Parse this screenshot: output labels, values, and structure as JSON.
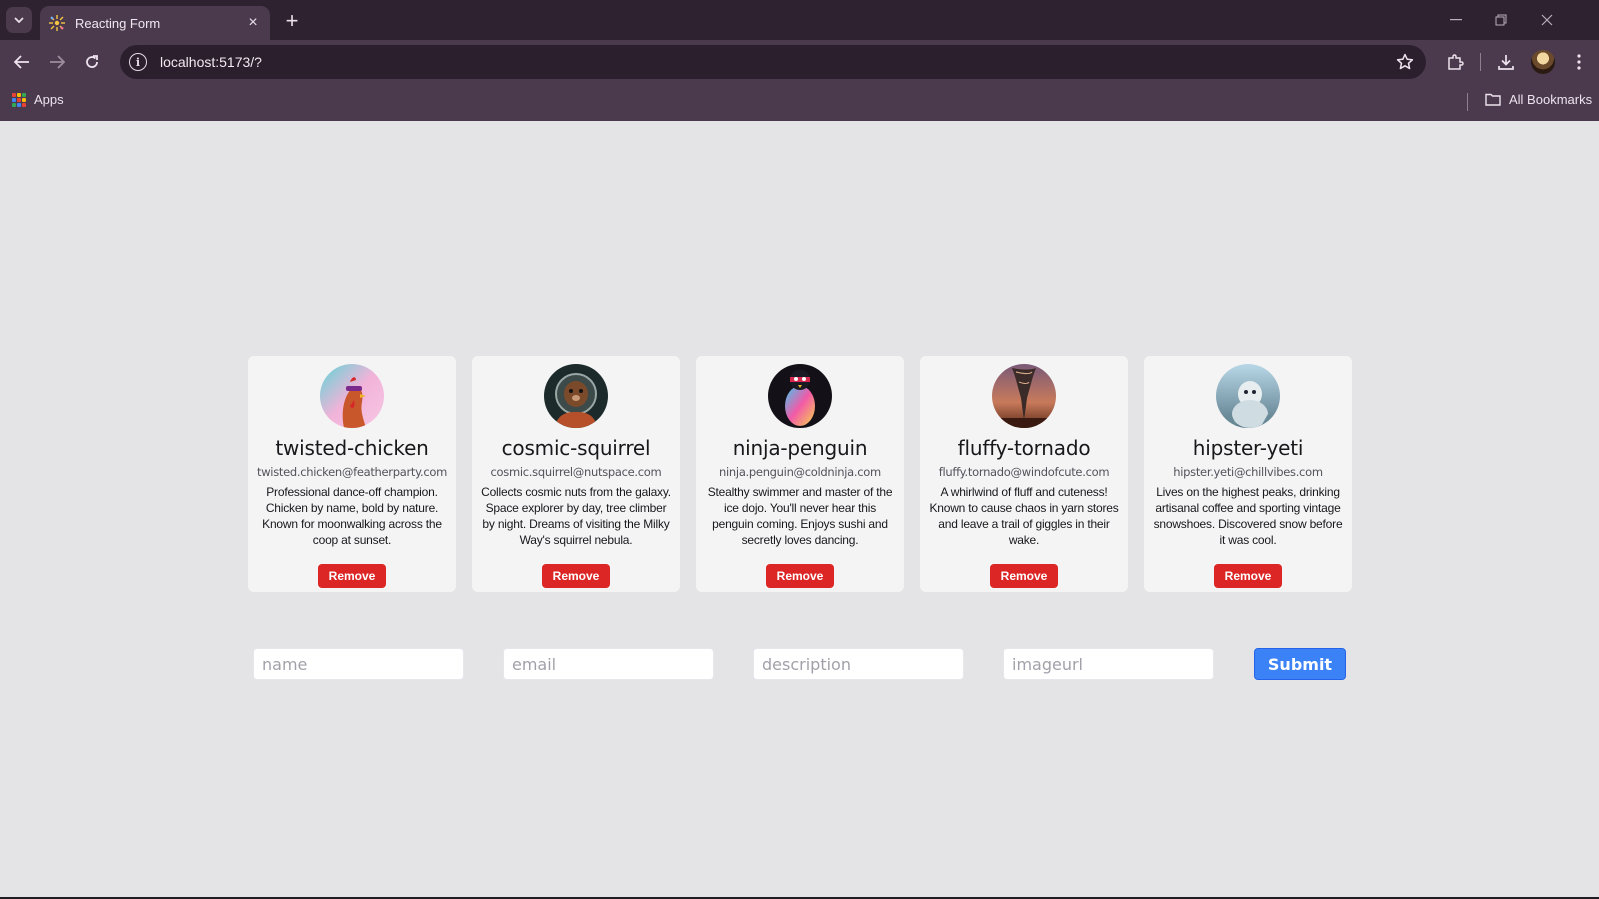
{
  "browser": {
    "tab_title": "Reacting Form",
    "url": "localhost:5173/?",
    "bookmarks_apps": "Apps",
    "all_bookmarks": "All Bookmarks"
  },
  "cards": [
    {
      "name": "twisted-chicken",
      "email": "twisted.chicken@featherparty.com",
      "description": "Professional dance-off champion. Chicken by name, bold by nature. Known for moonwalking across the coop at sunset.",
      "remove_label": "Remove"
    },
    {
      "name": "cosmic-squirrel",
      "email": "cosmic.squirrel@nutspace.com",
      "description": "Collects cosmic nuts from the galaxy. Space explorer by day, tree climber by night. Dreams of visiting the Milky Way's squirrel nebula.",
      "remove_label": "Remove"
    },
    {
      "name": "ninja-penguin",
      "email": "ninja.penguin@coldninja.com",
      "description": "Stealthy swimmer and master of the ice dojo. You'll never hear this penguin coming. Enjoys sushi and secretly loves dancing.",
      "remove_label": "Remove"
    },
    {
      "name": "fluffy-tornado",
      "email": "fluffy.tornado@windofcute.com",
      "description": "A whirlwind of fluff and cuteness! Known to cause chaos in yarn stores and leave a trail of giggles in their wake.",
      "remove_label": "Remove"
    },
    {
      "name": "hipster-yeti",
      "email": "hipster.yeti@chillvibes.com",
      "description": "Lives on the highest peaks, drinking artisanal coffee and sporting vintage snowshoes. Discovered snow before it was cool.",
      "remove_label": "Remove"
    }
  ],
  "form": {
    "name_placeholder": "name",
    "email_placeholder": "email",
    "description_placeholder": "description",
    "imageurl_placeholder": "imageurl",
    "submit_label": "Submit"
  },
  "colors": {
    "remove_button": "#dc2626",
    "submit_button": "#3b82f6",
    "page_background": "#e4e4e7",
    "card_background": "#f4f4f5"
  }
}
